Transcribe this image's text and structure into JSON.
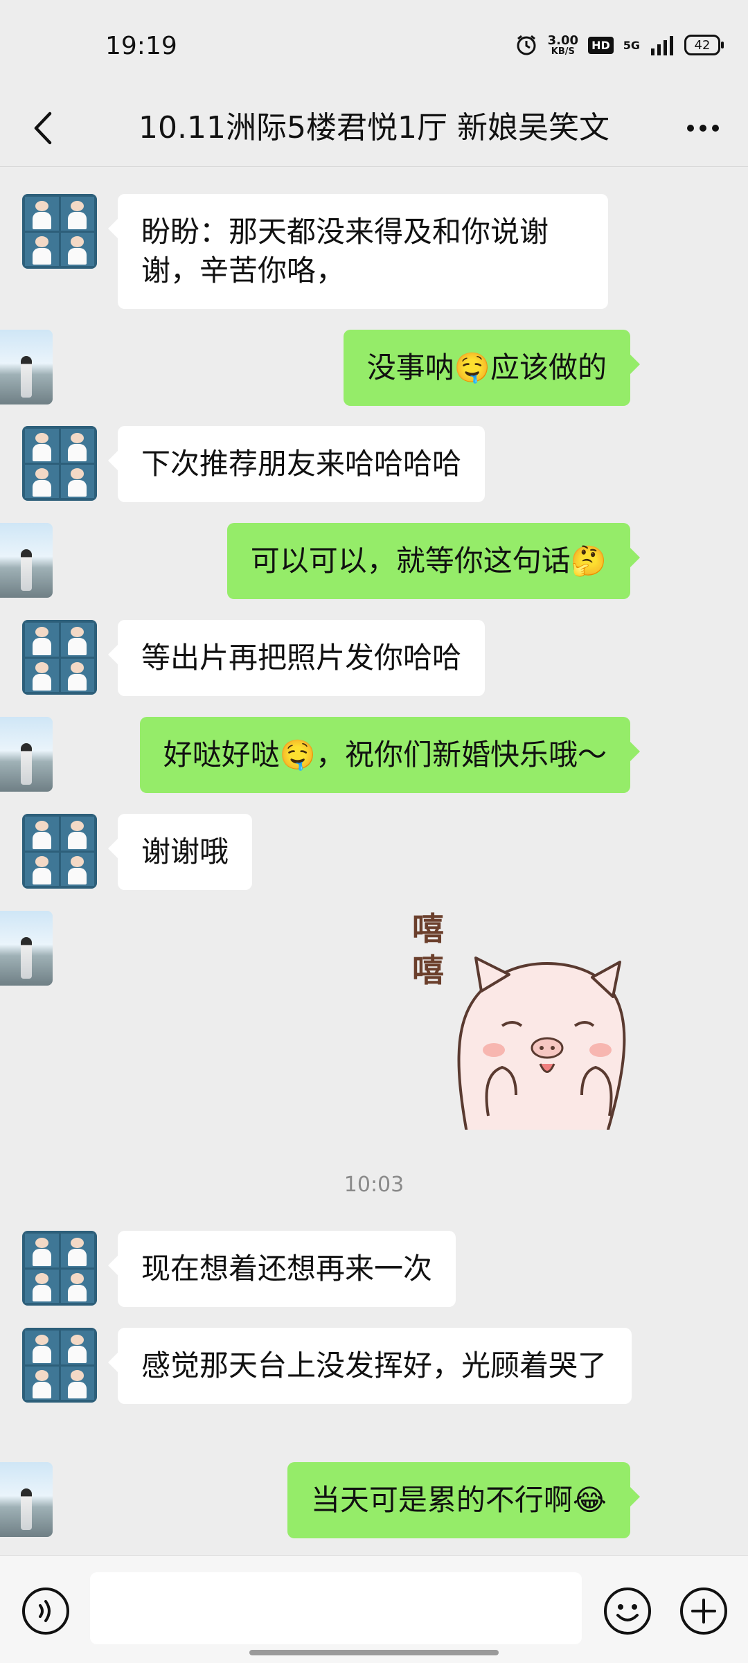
{
  "status": {
    "time": "19:19",
    "speed_value": "3.00",
    "speed_unit": "KB/S",
    "hd": "HD",
    "network": "5G",
    "battery": "42"
  },
  "header": {
    "title": "10.11洲际5楼君悦1厅 新娘吴笑文"
  },
  "messages": [
    {
      "side": "left",
      "text": "盼盼：那天都没来得及和你说谢谢，辛苦你咯，"
    },
    {
      "side": "right",
      "text": "没事呐🤤应该做的"
    },
    {
      "side": "left",
      "text": "下次推荐朋友来哈哈哈哈"
    },
    {
      "side": "right",
      "text": "可以可以，就等你这句话🤔"
    },
    {
      "side": "left",
      "text": "等出片再把照片发你哈哈"
    },
    {
      "side": "right",
      "text": "好哒好哒🤤，祝你们新婚快乐哦～"
    },
    {
      "side": "left",
      "text": "谢谢哦"
    },
    {
      "side": "right",
      "type": "sticker",
      "text": "嘻嘻"
    },
    {
      "type": "time",
      "text": "10:03"
    },
    {
      "side": "left",
      "text": "现在想着还想再来一次"
    },
    {
      "side": "left",
      "text": "感觉那天台上没发挥好，光顾着哭了"
    },
    {
      "side": "right",
      "text": "当天可是累的不行啊😂"
    }
  ],
  "input": {
    "placeholder": ""
  },
  "colors": {
    "background": "#ededed",
    "sent_bubble": "#95ec69",
    "received_bubble": "#ffffff"
  },
  "icons": {
    "back": "chevron-left-icon",
    "more": "more-dots-icon",
    "voice": "voice-icon",
    "emoji": "emoji-icon",
    "plus": "plus-icon"
  }
}
